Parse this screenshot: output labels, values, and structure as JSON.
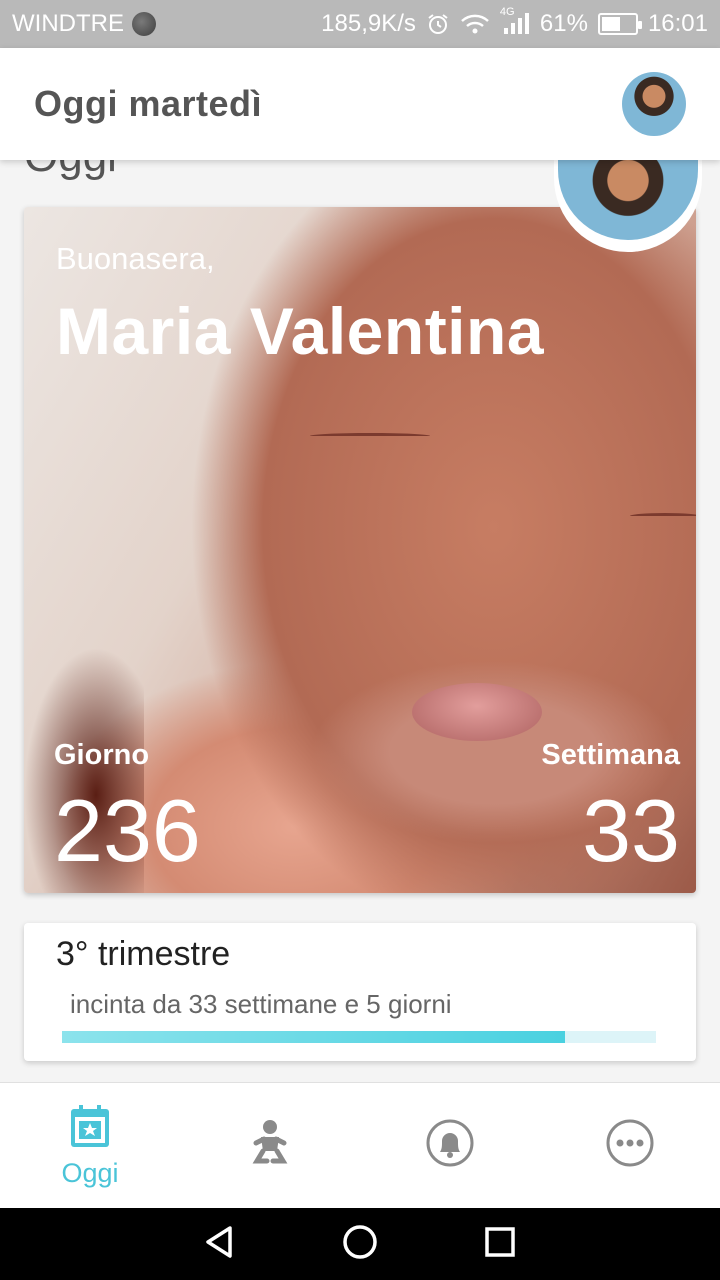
{
  "status_bar": {
    "carrier": "WINDTRE",
    "net_speed": "185,9K/s",
    "network": "4G",
    "battery": "61%",
    "battery_level": 0.61,
    "time": "16:01"
  },
  "app_bar": {
    "title": "Oggi martedì"
  },
  "section_title_peek": "Oggi",
  "hero": {
    "greeting": "Buonasera,",
    "name": "Maria Valentina",
    "day_label": "Giorno",
    "day_value": "236",
    "week_label": "Settimana",
    "week_value": "33"
  },
  "trimester_card": {
    "title": "3° trimestre",
    "subtitle": "incinta da 33 settimane e 5 giorni",
    "progress": 0.846
  },
  "bottom_nav": {
    "items": [
      {
        "label": "Oggi",
        "icon": "calendar-star-icon",
        "active": true
      },
      {
        "label": "",
        "icon": "baby-icon",
        "active": false
      },
      {
        "label": "",
        "icon": "community-bell-icon",
        "active": false
      },
      {
        "label": "",
        "icon": "more-icon",
        "active": false
      }
    ]
  },
  "colors": {
    "accent": "#4ac4d8",
    "progress_track": "#ddf4f8",
    "status_bar": "#b9b9b9"
  }
}
